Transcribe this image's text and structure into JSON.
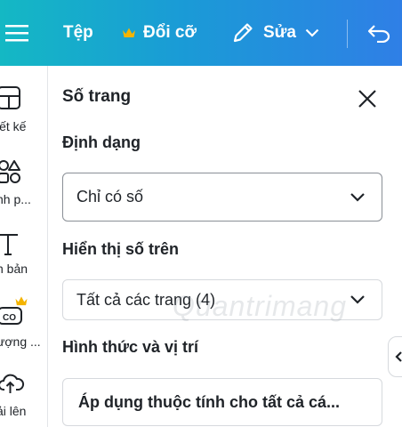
{
  "colors": {
    "topbar_start": "#14b8c4",
    "topbar_end": "#2f7fe6",
    "crown": "#f4b400"
  },
  "topbar": {
    "file_label": "Tệp",
    "resize_label": "Đổi cỡ",
    "edit_label": "Sửa",
    "icons": {
      "menu": "hamburger-icon",
      "resize": "crown-icon",
      "edit": "pencil-icon",
      "undo": "undo-icon"
    }
  },
  "sidebar": {
    "items": [
      {
        "label": "iết kế",
        "icon": "design-layout-icon"
      },
      {
        "label": "nh p...",
        "icon": "elements-shapes-icon"
      },
      {
        "label": "n bản",
        "icon": "text-icon"
      },
      {
        "label": "ượng ...",
        "icon": "brand-kit-icon"
      },
      {
        "label": "ải lên",
        "icon": "upload-cloud-icon"
      }
    ]
  },
  "panel": {
    "title": "Số trang",
    "format_label": "Định dạng",
    "format_value": "Chỉ có số",
    "show_on_label": "Hiển thị số trên",
    "show_on_value": "Tất cả các trang (4)",
    "style_position_label": "Hình thức và vị trí",
    "apply_all_label": "Áp dụng thuộc tính cho tất cả cá..."
  },
  "watermark": "Quantrimang"
}
